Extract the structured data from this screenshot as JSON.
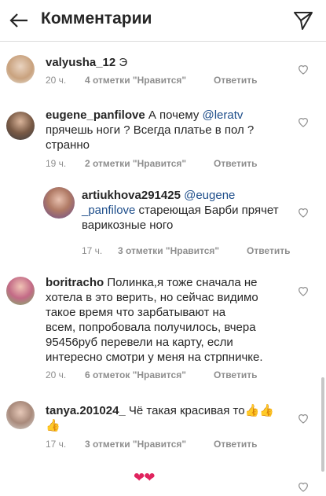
{
  "header": {
    "title": "Комментарии"
  },
  "comments": [
    {
      "user": "valyusha_12",
      "text": " Э",
      "time": "20 ч.",
      "likes": "4 отметки \"Нравится\"",
      "reply": "Ответить"
    },
    {
      "user": "eugene_panfilove",
      "text_parts": [
        " А почему ",
        "@leratv",
        " прячешь ноги ? Всегда платье в пол ? странно"
      ],
      "line1": "eugene_panfilove А почему @leratv",
      "time": "19 ч.",
      "likes": "2 отметки \"Нравится\"",
      "reply": "Ответить"
    },
    {
      "user": "artiukhova291425",
      "mention": "@eugene_panfilove",
      "time": "17 ч.",
      "likes": "3 отметки \"Нравится\"",
      "reply": "Ответить"
    },
    {
      "user": "boritracho",
      "time": "20 ч.",
      "likes": "6 отметок \"Нравится\"",
      "reply": "Ответить"
    },
    {
      "user": "tanya.201024_",
      "text": " Чё такая красивая то",
      "time": "17 ч.",
      "likes": "3 отметки \"Нравится\"",
      "reply": "Ответить"
    }
  ],
  "lines": {
    "c2l1a": " А почему ",
    "c2l1m": "@leratv",
    "c2l2": "прячешь ноги ? Всегда платье в пол ?",
    "c2l3": "странно",
    "c3l1m": "@eugene",
    "c3l2m": "_panfilove",
    "c3l2t": " стареющая Барби прячет",
    "c3l3": "варикозные ного",
    "c4l1": " Полинка,я тоже сначала не",
    "c4l2": "хотела в это верить, но сейчас видимо",
    "c4l3": "такое время что зарбатывают на",
    "c4l4": "всем, попробовала получилось, вчера",
    "c4l5": "95456руб перевели на карту, если",
    "c4l6": "интересно смотри у меня на стрпничке.",
    "c5emoji": "👍👍",
    "c5emoji2": "👍"
  },
  "icons": [
    "back-arrow-icon",
    "send-icon",
    "heart-icon"
  ],
  "extra": {
    "hearts": "❤❤"
  }
}
